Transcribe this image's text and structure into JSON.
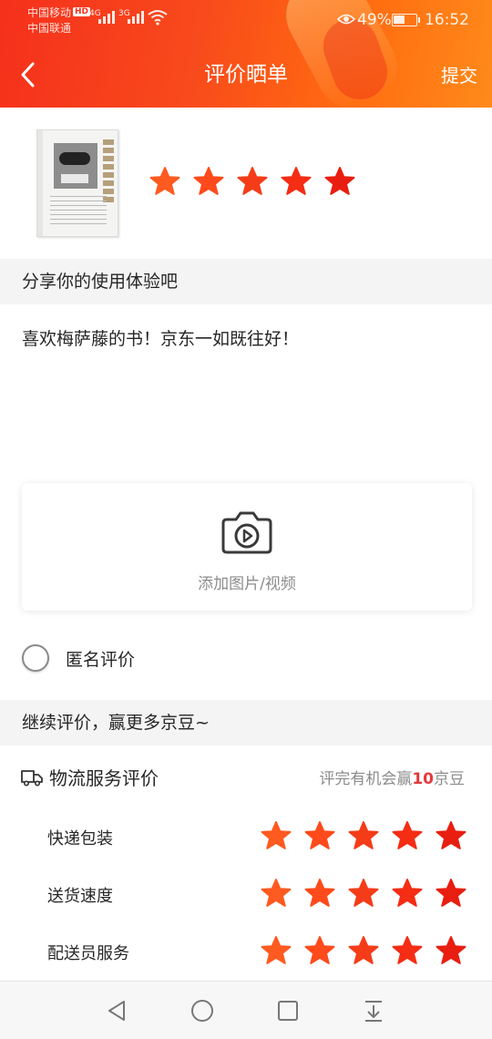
{
  "status_bar": {
    "carrier_1": "中国移动",
    "carrier_2": "中国联通",
    "hd": "HD",
    "net_1": "4G",
    "net_2": "3G",
    "battery": "49%",
    "time": "16:52"
  },
  "nav": {
    "back_icon": "chevron-left-icon",
    "title": "评价晒单",
    "submit": "提交"
  },
  "product": {
    "image_icon": "book-cover-thumbnail",
    "rating": 5,
    "star_colors": [
      "#ff5a1f",
      "#ff4a1b",
      "#f53c18",
      "#f42d14",
      "#e81e10"
    ]
  },
  "review": {
    "section_title": "分享你的使用体验吧",
    "text": "喜欢梅萨藤的书！京东一如既往好！",
    "upload_label": "添加图片/视频",
    "anonymous_label": "匿名评价"
  },
  "continue": {
    "section_title": "继续评价，赢更多京豆~"
  },
  "logistics": {
    "title": "物流服务评价",
    "reward_prefix": "评完有机会赢",
    "reward_number": "10",
    "reward_suffix": "京豆",
    "rows": [
      {
        "label": "快递包装",
        "rating": 5
      },
      {
        "label": "送货速度",
        "rating": 5
      },
      {
        "label": "配送员服务",
        "rating": 5
      }
    ]
  },
  "system_nav": {
    "icons": [
      "back-triangle-icon",
      "home-circle-icon",
      "recents-square-icon",
      "notification-pulldown-icon"
    ]
  }
}
